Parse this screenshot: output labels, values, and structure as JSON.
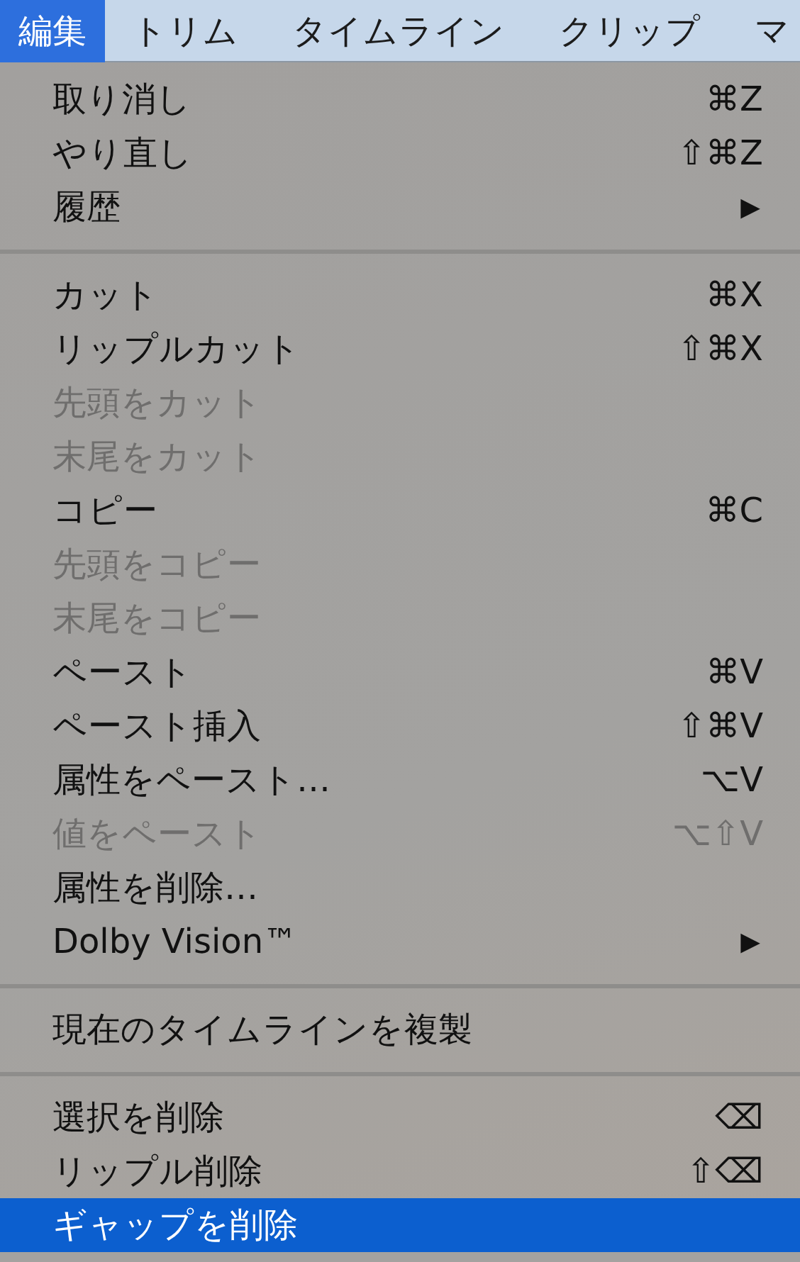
{
  "menubar": [
    {
      "label": "編集",
      "selected": true
    },
    {
      "label": "トリム",
      "selected": false
    },
    {
      "label": "タイムライン",
      "selected": false
    },
    {
      "label": "クリップ",
      "selected": false
    },
    {
      "label": "マ",
      "selected": false
    }
  ],
  "menu": {
    "items": [
      {
        "kind": "item",
        "label": "取り消し",
        "shortcut": "⌘Z",
        "disabled": false,
        "selected": false
      },
      {
        "kind": "item",
        "label": "やり直し",
        "shortcut": "⇧⌘Z",
        "disabled": false,
        "selected": false
      },
      {
        "kind": "item",
        "label": "履歴",
        "submenu": "▶",
        "disabled": false,
        "selected": false
      },
      {
        "kind": "separator"
      },
      {
        "kind": "item",
        "label": "カット",
        "shortcut": "⌘X",
        "disabled": false,
        "selected": false
      },
      {
        "kind": "item",
        "label": "リップルカット",
        "shortcut": "⇧⌘X",
        "disabled": false,
        "selected": false
      },
      {
        "kind": "item",
        "label": "先頭をカット",
        "disabled": true,
        "selected": false
      },
      {
        "kind": "item",
        "label": "末尾をカット",
        "disabled": true,
        "selected": false
      },
      {
        "kind": "item",
        "label": "コピー",
        "shortcut": "⌘C",
        "disabled": false,
        "selected": false
      },
      {
        "kind": "item",
        "label": "先頭をコピー",
        "disabled": true,
        "selected": false
      },
      {
        "kind": "item",
        "label": "末尾をコピー",
        "disabled": true,
        "selected": false
      },
      {
        "kind": "item",
        "label": "ペースト",
        "shortcut": "⌘V",
        "disabled": false,
        "selected": false
      },
      {
        "kind": "item",
        "label": "ペースト挿入",
        "shortcut": "⇧⌘V",
        "disabled": false,
        "selected": false
      },
      {
        "kind": "item",
        "label": "属性をペースト…",
        "shortcut": "⌥V",
        "disabled": false,
        "selected": false
      },
      {
        "kind": "item",
        "label": "値をペースト",
        "shortcut": "⌥⇧V",
        "disabled": true,
        "selected": false
      },
      {
        "kind": "item",
        "label": "属性を削除…",
        "disabled": false,
        "selected": false
      },
      {
        "kind": "item",
        "label": "Dolby Vision™",
        "submenu": "▶",
        "disabled": false,
        "selected": false
      },
      {
        "kind": "separator"
      },
      {
        "kind": "item",
        "label": "現在のタイムラインを複製",
        "disabled": false,
        "selected": false
      },
      {
        "kind": "separator"
      },
      {
        "kind": "item",
        "label": "選択を削除",
        "shortcut": "⌫",
        "disabled": false,
        "selected": false
      },
      {
        "kind": "item",
        "label": "リップル削除",
        "shortcut": "⇧⌫",
        "disabled": false,
        "selected": false
      },
      {
        "kind": "item",
        "label": "ギャップを削除",
        "disabled": false,
        "selected": true
      }
    ]
  }
}
